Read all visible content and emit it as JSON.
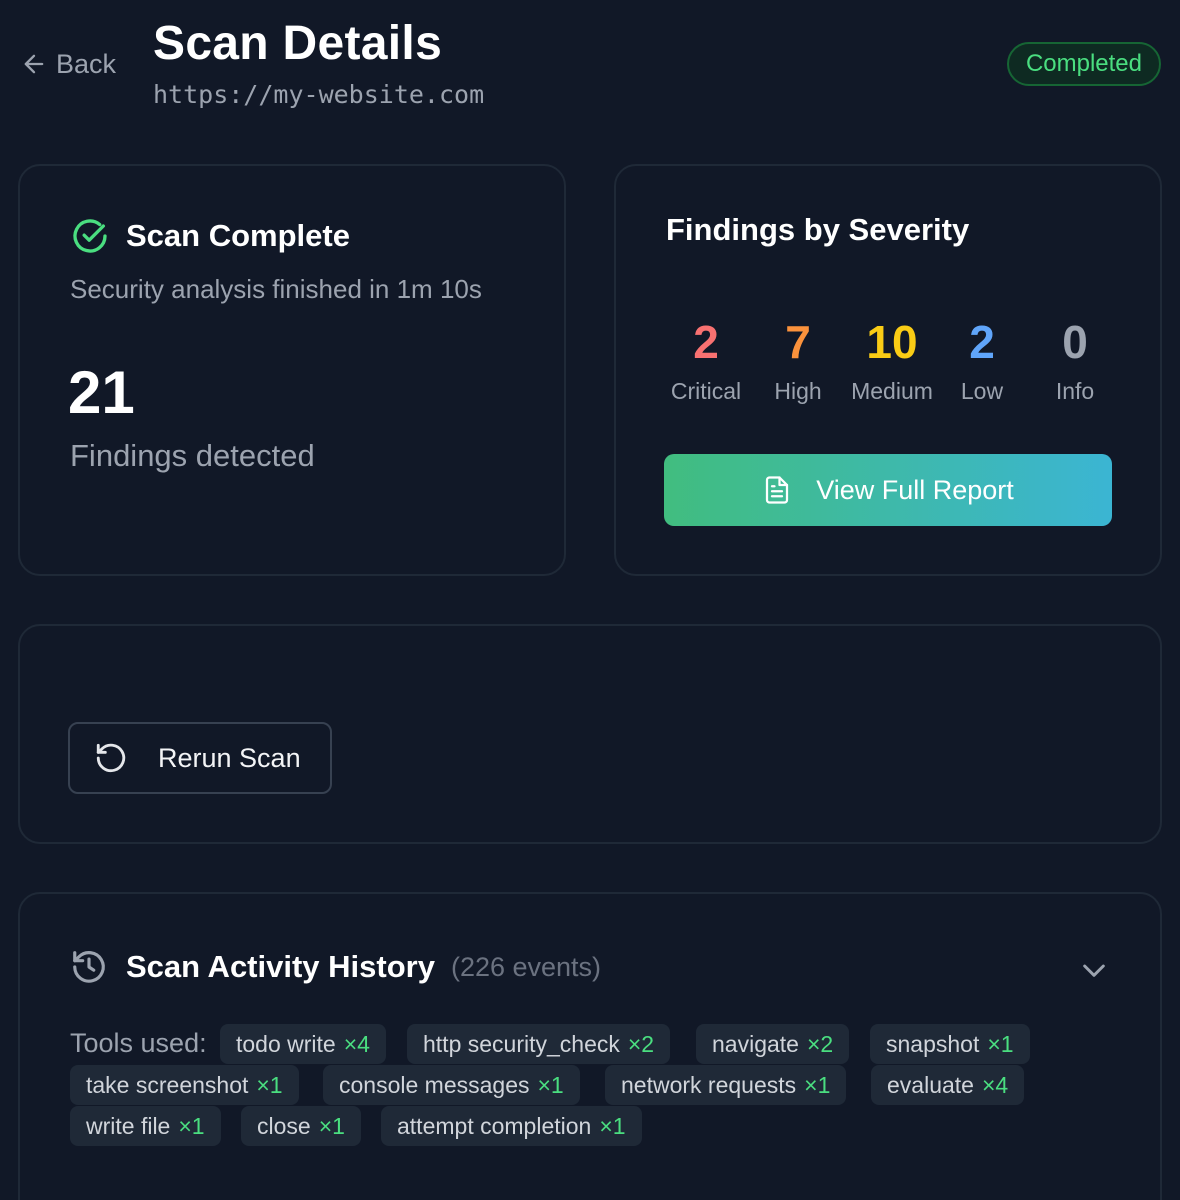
{
  "header": {
    "back_label": "Back",
    "title": "Scan Details",
    "url": "https://my-website.com",
    "status": "Completed"
  },
  "scan_card": {
    "title": "Scan Complete",
    "subtitle": "Security analysis finished in 1m 10s",
    "total": "21",
    "total_label": "Findings detected"
  },
  "severity_card": {
    "title": "Findings by Severity",
    "items": [
      {
        "count": "2",
        "label": "Critical",
        "color": "#f87171"
      },
      {
        "count": "7",
        "label": "High",
        "color": "#fb923c"
      },
      {
        "count": "10",
        "label": "Medium",
        "color": "#facc15"
      },
      {
        "count": "2",
        "label": "Low",
        "color": "#60a5fa"
      },
      {
        "count": "0",
        "label": "Info",
        "color": "#9ca3af"
      }
    ],
    "report_button": "View Full Report"
  },
  "actions": {
    "rerun_button": "Rerun Scan"
  },
  "history": {
    "title": "Scan Activity History",
    "events": "(226 events)",
    "tools_label": "Tools used:",
    "tools": [
      {
        "name": "todo write",
        "count": "×4"
      },
      {
        "name": "http security_check",
        "count": "×2"
      },
      {
        "name": "navigate",
        "count": "×2"
      },
      {
        "name": "snapshot",
        "count": "×1"
      },
      {
        "name": "take screenshot",
        "count": "×1"
      },
      {
        "name": "console messages",
        "count": "×1"
      },
      {
        "name": "network requests",
        "count": "×1"
      },
      {
        "name": "evaluate",
        "count": "×4"
      },
      {
        "name": "write file",
        "count": "×1"
      },
      {
        "name": "close",
        "count": "×1"
      },
      {
        "name": "attempt completion",
        "count": "×1"
      }
    ]
  },
  "icons": {
    "back": "arrow-left-icon",
    "scan_complete": "check-circle-icon",
    "report": "document-icon",
    "rerun": "refresh-icon",
    "history": "history-icon",
    "expand": "chevron-down-icon"
  },
  "colors": {
    "background": "#111827",
    "accent_green": "#4ade80",
    "gradient_start": "#41bd7f",
    "gradient_end": "#3bb5d3"
  }
}
